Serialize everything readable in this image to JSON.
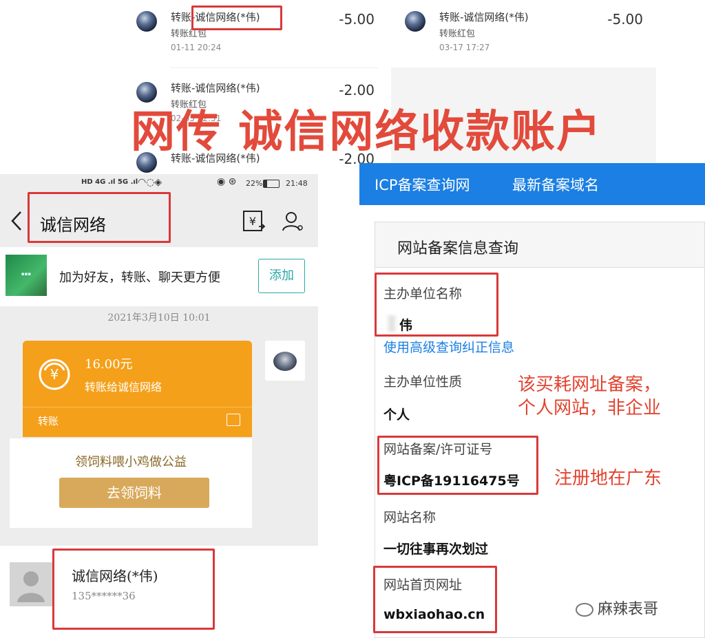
{
  "transfers": [
    {
      "name": "转账-诚信网络(*伟)",
      "sub": "转账红包",
      "time": "01-11  20:24",
      "amount": "-5.00"
    },
    {
      "name": "转账-诚信网络(*伟)",
      "sub": "转账红包",
      "time": "03-17  17:27",
      "amount": "-5.00"
    },
    {
      "name": "转账-诚信网络(*伟)",
      "sub": "转账红包",
      "time": "02-05  22:51",
      "amount": "-2.00"
    },
    {
      "name": "转账-诚信网络(*伟)",
      "sub": "",
      "time": "",
      "amount": "-2.00"
    }
  ],
  "highlight_name": "诚信网络(*伟)",
  "headline": "网传 诚信网络收款账户",
  "phone": {
    "status_icons": "HD 4G .ıl 5G .ıl",
    "battery": "22%",
    "clock": "21:48",
    "title": "诚信网络",
    "back_icon": "chevron-left-icon",
    "add_friend_text": "加为好友，转账、聊天更方便",
    "add_button": "添加",
    "date": "2021年3月10日  10:01",
    "card_amount": "16.00元",
    "card_desc": "转账给诚信网络",
    "card_footer": "转账",
    "promo_text": "领饲料喂小鸡做公益",
    "promo_button": "去领饲料",
    "contact_name": "诚信网络(*伟)",
    "contact_phone": "135******36"
  },
  "icp": {
    "nav_items": [
      "ICP备案查询网",
      "最新备案域名"
    ],
    "card_title": "网站备案信息查询",
    "fields": [
      {
        "label": "主办单位名称",
        "value": "伟"
      },
      {
        "label": "主办单位性质",
        "value": "个人"
      },
      {
        "label": "网站备案/许可证号",
        "value": "粤ICP备19116475号"
      },
      {
        "label": "网站名称",
        "value": "一切往事再次划过"
      },
      {
        "label": "网站首页网址",
        "value": "wbxiaohao.cn"
      }
    ],
    "link": "使用高级查询纠正信息"
  },
  "annotations": {
    "note1_line1": "该买耗网址备案，",
    "note1_line2": "个人网站，非企业",
    "note2": "注册地在广东"
  },
  "watermark": "麻辣表哥",
  "colors": {
    "accent_red": "#d9383a",
    "headline_red": "#e24a3b",
    "icp_blue": "#1b7fe3",
    "card_orange": "#f5a01a"
  }
}
